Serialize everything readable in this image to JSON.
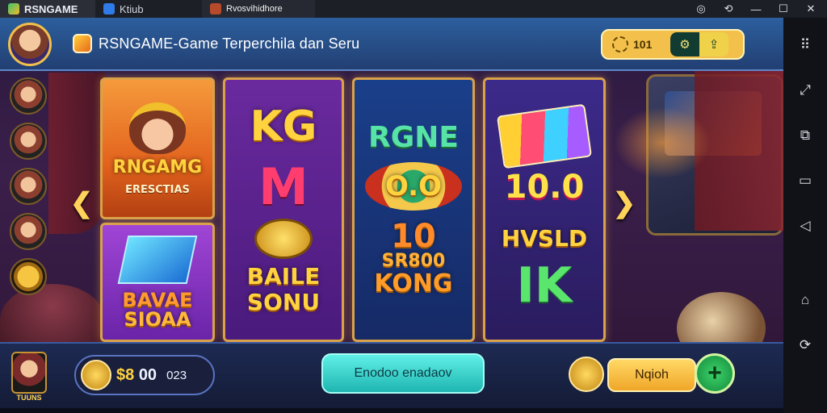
{
  "chrome": {
    "tabs": [
      {
        "label": "RSNGAME",
        "active": true
      },
      {
        "label": "Ktiub",
        "active": false
      },
      {
        "label": "Rvosvihidhore",
        "active": false
      }
    ],
    "icons": [
      "instagram-icon",
      "share-icon",
      "minimize-icon",
      "maximize-icon",
      "close-icon"
    ]
  },
  "header": {
    "title": "RSNGAME-Game Terperchila dan Seru",
    "coins": "101"
  },
  "cards": {
    "c1a": {
      "title": "RNGAMG",
      "subtitle": "ERESCTIAS"
    },
    "c1b": {
      "title": "BAVAE",
      "subtitle": "SIOAA"
    },
    "c2": {
      "top": "KG",
      "mid": "M",
      "bot1": "BAILE",
      "bot2": "SONU"
    },
    "c3": {
      "top": "RGNE",
      "mid": "O.O",
      "num": "10",
      "mid2": "SR800",
      "bot": "KONG"
    },
    "c4": {
      "mid": "10.0",
      "text": "HVSLD",
      "bot": "IK"
    }
  },
  "footer": {
    "char_label": "TUUNS",
    "balance_symbol": "$8",
    "balance_value": "00",
    "balance_sub": "023",
    "main_button": "Enodoo enadaov",
    "secondary_button": "Nqioh",
    "plus_label": "+"
  },
  "colors": {
    "accent_gold": "#f2c04b",
    "header_blue": "#2c5f9d",
    "teal_button": "#1fb5b0",
    "plus_green": "#138a3a"
  }
}
